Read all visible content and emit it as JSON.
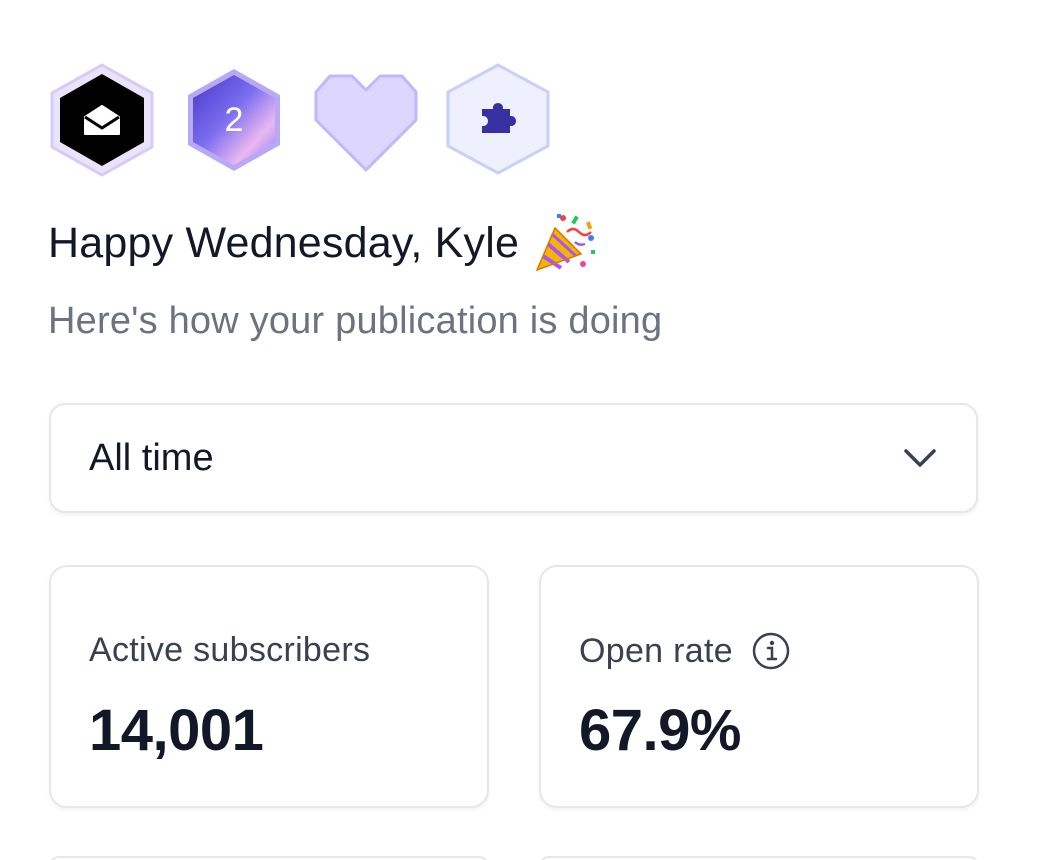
{
  "badges": [
    {
      "name": "newsletter-badge",
      "icon": "envelope-open-icon"
    },
    {
      "name": "level-badge",
      "number": "2"
    },
    {
      "name": "heart-badge",
      "icon": "heart-icon"
    },
    {
      "name": "integration-badge",
      "icon": "puzzle-piece-icon"
    }
  ],
  "greeting": {
    "text": "Happy Wednesday, Kyle",
    "emoji": "party-popper-icon"
  },
  "subtitle": "Here's how your publication is doing",
  "time_filter": {
    "selected": "All time"
  },
  "stats": {
    "active_subscribers": {
      "label": "Active subscribers",
      "value": "14,001"
    },
    "open_rate": {
      "label": "Open rate",
      "value": "67.9%"
    }
  },
  "colors": {
    "text_primary": "#111827",
    "text_secondary": "#6b7280",
    "border": "#e5e7eb",
    "badge_accent": "#c4b5fd",
    "badge_purple": "#6d5ce7",
    "puzzle_blue": "#3730a3"
  }
}
